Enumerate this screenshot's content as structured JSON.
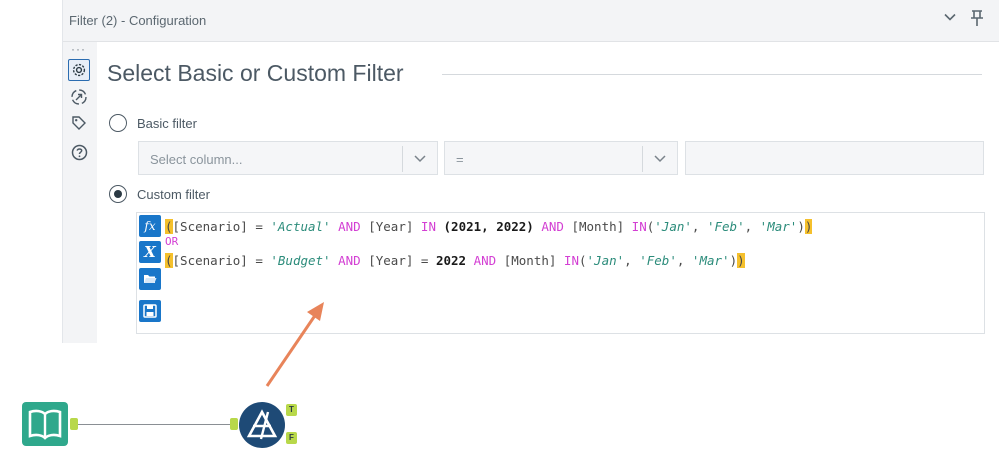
{
  "window": {
    "title": "Filter (2) - Configuration"
  },
  "header": {
    "chevron_icon": "chevron-down-icon",
    "pin_icon": "pin-icon",
    "dots": "···"
  },
  "sidebar": {
    "items": [
      {
        "name": "settings",
        "icon": "gear-icon",
        "active": true
      },
      {
        "name": "annotation",
        "icon": "navigate-icon",
        "active": false
      },
      {
        "name": "tag",
        "icon": "tag-icon",
        "active": false
      },
      {
        "name": "help",
        "icon": "help-icon",
        "active": false
      }
    ]
  },
  "section": {
    "heading": "Select Basic or Custom Filter"
  },
  "basic_filter": {
    "label": "Basic filter",
    "selected": false,
    "column_placeholder": "Select column...",
    "operator_value": "=",
    "value_text": ""
  },
  "custom_filter": {
    "label": "Custom filter",
    "selected": true,
    "expression_lines": [
      "([Scenario] = 'Actual' AND [Year] IN (2021, 2022) AND [Month] IN('Jan', 'Feb', 'Mar'))",
      "OR",
      "([Scenario] = 'Budget' AND [Year] = 2022 AND [Month] IN('Jan', 'Feb', 'Mar'))"
    ],
    "tool_buttons": [
      {
        "icon": "function-icon",
        "glyph": "fx"
      },
      {
        "icon": "variable-icon",
        "glyph": "X"
      },
      {
        "icon": "open-folder-icon",
        "glyph": ""
      },
      {
        "icon": "save-icon",
        "glyph": ""
      }
    ]
  },
  "workflow": {
    "input_tool": "book-input-icon",
    "filter_tool": "filter-tool-icon",
    "anchors": {
      "true": "T",
      "false": "F"
    }
  },
  "colors": {
    "accent_blue": "#1976c9",
    "keyword_magenta": "#d33fd3",
    "string_teal": "#2c8c7b",
    "bracket_highlight": "#f5c02c",
    "arrow_annotation": "#e8845a",
    "input_tool_green": "#2fa88c",
    "filter_tool_navy": "#1e4a76",
    "anchor_green": "#b8d84a"
  }
}
